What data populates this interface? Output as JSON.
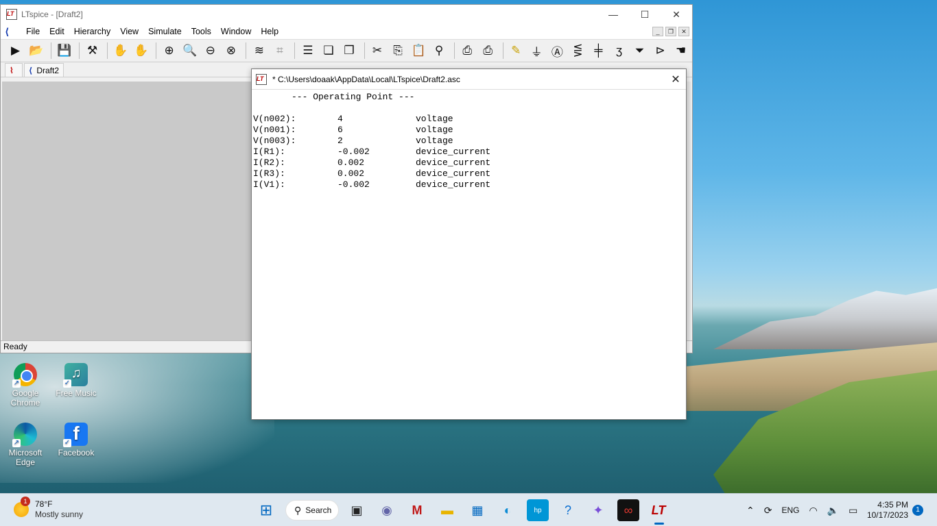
{
  "main_window": {
    "title": "LTspice - [Draft2]",
    "menu": [
      "File",
      "Edit",
      "Hierarchy",
      "View",
      "Simulate",
      "Tools",
      "Window",
      "Help"
    ],
    "tab": "Draft2",
    "status": "Ready"
  },
  "op_window": {
    "title": "* C:\\Users\\doaak\\AppData\\Local\\LTspice\\Draft2.asc",
    "header": "--- Operating Point ---",
    "rows": [
      {
        "name": "V(n002):",
        "value": "4",
        "type": "voltage"
      },
      {
        "name": "V(n001):",
        "value": "6",
        "type": "voltage"
      },
      {
        "name": "V(n003):",
        "value": "2",
        "type": "voltage"
      },
      {
        "name": "I(R1):",
        "value": "-0.002",
        "type": "device_current"
      },
      {
        "name": "I(R2):",
        "value": "0.002",
        "type": "device_current"
      },
      {
        "name": "I(R3):",
        "value": "0.002",
        "type": "device_current"
      },
      {
        "name": "I(V1):",
        "value": "-0.002",
        "type": "device_current"
      }
    ]
  },
  "desktop_icons": [
    {
      "label": "Google Chrome"
    },
    {
      "label": "Free Music"
    },
    {
      "label": "Microsoft Edge"
    },
    {
      "label": "Facebook"
    }
  ],
  "taskbar": {
    "weather_temp": "78°F",
    "weather_cond": "Mostly sunny",
    "weather_badge": "1",
    "search_label": "Search",
    "language": "ENG",
    "time": "4:35 PM",
    "date": "10/17/2023",
    "notification_count": "1"
  }
}
